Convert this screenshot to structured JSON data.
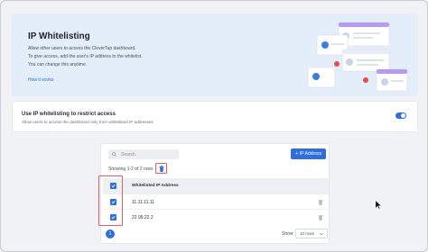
{
  "hero": {
    "title": "IP Whitelisting",
    "lines": [
      "Allow other users to access the CleverTap dashboard.",
      "To give access, add the user's IP address to the whitelist.",
      "You can change this anytime."
    ],
    "link": "How it works"
  },
  "restrict": {
    "title": "Use IP whitelisting to restrict access",
    "subtitle": "Allow users to access the dashboard only from whitelisted IP addresses",
    "enabled": true
  },
  "table": {
    "search_placeholder": "Search",
    "add_button": "IP Address",
    "rows_info": "Showing 1-2 of 2 rows",
    "column_header": "Whitelisted IP Address",
    "rows": [
      {
        "ip": "11.11.11.11",
        "checked": true
      },
      {
        "ip": "22.99.22.2",
        "checked": true
      }
    ],
    "header_checked": true
  },
  "pagination": {
    "current_page": "1",
    "show_label": "Show",
    "rows_per_page": "10 rows"
  },
  "colors": {
    "accent": "#2e6fdc",
    "highlight": "#d9645c",
    "hero_bg": "#e4edfa"
  }
}
